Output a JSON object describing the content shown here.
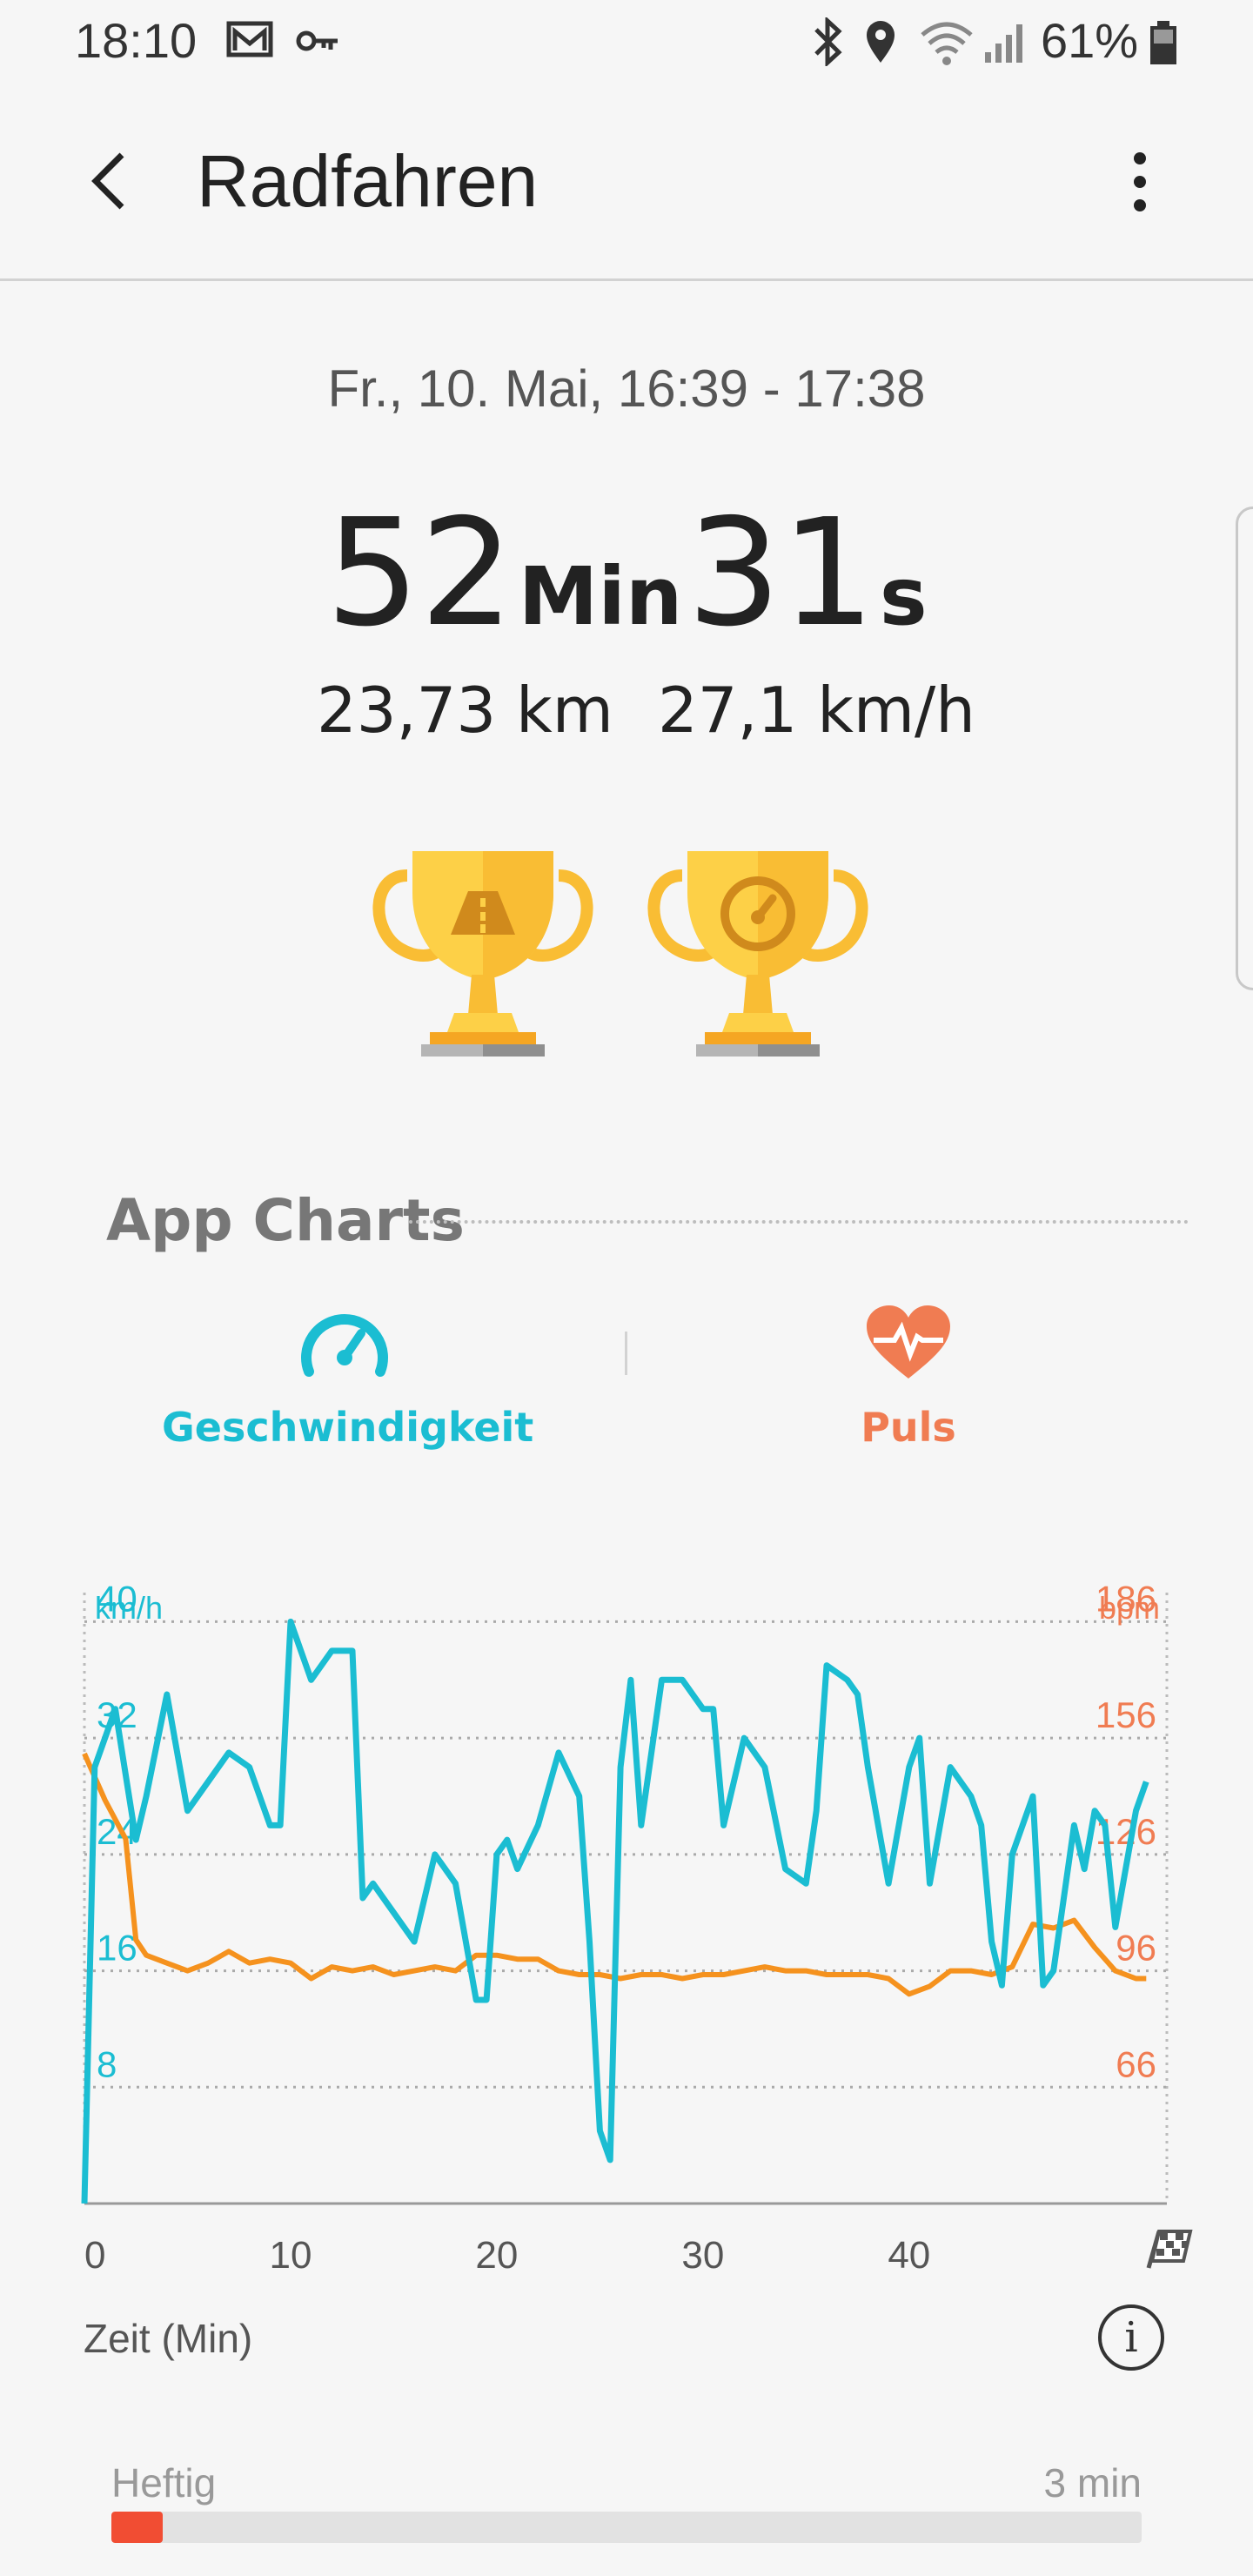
{
  "status_bar": {
    "time": "18:10",
    "battery": "61%"
  },
  "app_bar": {
    "title": "Radfahren"
  },
  "summary": {
    "date_range": "Fr., 10. Mai, 16:39 - 17:38",
    "duration_minutes": "52",
    "duration_min_unit": "Min",
    "duration_seconds": "31",
    "duration_sec_unit": "s",
    "distance": "23,73 km",
    "avg_speed": "27,1 km/h"
  },
  "achievements": [
    {
      "icon": "trophy-road-icon"
    },
    {
      "icon": "trophy-speedometer-icon"
    }
  ],
  "section": {
    "title": "App Charts"
  },
  "tabs": [
    {
      "label": "Geschwindigkeit",
      "icon": "speedometer-icon",
      "color": "#1bbdd2"
    },
    {
      "label": "Puls",
      "icon": "heart-icon",
      "color": "#f07c52"
    }
  ],
  "colors": {
    "speed": "#1bbdd2",
    "pulse": "#f5921e",
    "pulse_axis": "#f07c52",
    "intensity_bar": "#f14d33"
  },
  "chart_data": {
    "type": "line",
    "y_left_unit": "km/h",
    "y_right_unit": "bpm",
    "y_left_ticks": [
      8,
      16,
      24,
      32,
      40
    ],
    "y_right_ticks": [
      66,
      96,
      126,
      156,
      186
    ],
    "x_ticks": [
      0,
      10,
      20,
      30,
      40
    ],
    "xlabel": "Zeit (Min)",
    "xlim": [
      0,
      52.5
    ],
    "ylim_left": [
      0,
      42
    ],
    "series": [
      {
        "axis": "left",
        "points": [
          [
            0,
            0
          ],
          [
            0.5,
            30
          ],
          [
            1.5,
            34
          ],
          [
            2.5,
            25
          ],
          [
            3,
            28
          ],
          [
            4,
            35
          ],
          [
            5,
            27
          ],
          [
            6,
            29
          ],
          [
            7,
            31
          ],
          [
            8,
            30
          ],
          [
            9,
            26
          ],
          [
            9.5,
            26
          ],
          [
            10,
            40
          ],
          [
            10.5,
            38
          ],
          [
            11,
            36
          ],
          [
            12,
            38
          ],
          [
            13,
            38
          ],
          [
            13.5,
            21
          ],
          [
            14,
            22
          ],
          [
            15,
            20
          ],
          [
            16,
            18
          ],
          [
            17,
            24
          ],
          [
            18,
            22
          ],
          [
            19,
            14
          ],
          [
            19.5,
            14
          ],
          [
            20,
            24
          ],
          [
            20.5,
            25
          ],
          [
            21,
            23
          ],
          [
            22,
            26
          ],
          [
            23,
            31
          ],
          [
            24,
            28
          ],
          [
            24.5,
            18
          ],
          [
            25,
            5
          ],
          [
            25.5,
            3
          ],
          [
            26,
            30
          ],
          [
            26.5,
            36
          ],
          [
            27,
            26
          ],
          [
            28,
            36
          ],
          [
            29,
            36
          ],
          [
            30,
            34
          ],
          [
            30.5,
            34
          ],
          [
            31,
            26
          ],
          [
            32,
            32
          ],
          [
            33,
            30
          ],
          [
            34,
            23
          ],
          [
            35,
            22
          ],
          [
            35.5,
            27
          ],
          [
            36,
            37
          ],
          [
            37,
            36
          ],
          [
            37.5,
            35
          ],
          [
            38,
            30
          ],
          [
            39,
            22
          ],
          [
            40,
            30
          ],
          [
            40.5,
            32
          ],
          [
            41,
            22
          ],
          [
            42,
            30
          ],
          [
            43,
            28
          ],
          [
            43.5,
            26
          ],
          [
            44,
            18
          ],
          [
            44.5,
            15
          ],
          [
            45,
            24
          ],
          [
            46,
            28
          ],
          [
            46.5,
            15
          ],
          [
            47,
            16
          ],
          [
            48,
            26
          ],
          [
            48.5,
            23
          ],
          [
            49,
            27
          ],
          [
            49.5,
            26
          ],
          [
            50,
            19
          ],
          [
            51,
            27
          ],
          [
            51.5,
            29
          ]
        ]
      },
      {
        "axis": "right",
        "points": [
          [
            0,
            152
          ],
          [
            1,
            140
          ],
          [
            2,
            130
          ],
          [
            2.5,
            104
          ],
          [
            3,
            100
          ],
          [
            4,
            98
          ],
          [
            5,
            96
          ],
          [
            6,
            98
          ],
          [
            7,
            101
          ],
          [
            8,
            98
          ],
          [
            9,
            99
          ],
          [
            10,
            98
          ],
          [
            11,
            94
          ],
          [
            12,
            97
          ],
          [
            13,
            96
          ],
          [
            14,
            97
          ],
          [
            15,
            95
          ],
          [
            16,
            96
          ],
          [
            17,
            97
          ],
          [
            18,
            96
          ],
          [
            19,
            100
          ],
          [
            20,
            100
          ],
          [
            21,
            99
          ],
          [
            22,
            99
          ],
          [
            23,
            96
          ],
          [
            24,
            95
          ],
          [
            25,
            95
          ],
          [
            26,
            94
          ],
          [
            27,
            95
          ],
          [
            28,
            95
          ],
          [
            29,
            94
          ],
          [
            30,
            95
          ],
          [
            31,
            95
          ],
          [
            32,
            96
          ],
          [
            33,
            97
          ],
          [
            34,
            96
          ],
          [
            35,
            96
          ],
          [
            36,
            95
          ],
          [
            37,
            95
          ],
          [
            38,
            95
          ],
          [
            39,
            94
          ],
          [
            40,
            90
          ],
          [
            41,
            92
          ],
          [
            42,
            96
          ],
          [
            43,
            96
          ],
          [
            44,
            95
          ],
          [
            45,
            97
          ],
          [
            46,
            108
          ],
          [
            47,
            107
          ],
          [
            48,
            109
          ],
          [
            49,
            102
          ],
          [
            50,
            96
          ],
          [
            51,
            94
          ],
          [
            51.5,
            94
          ]
        ]
      }
    ]
  },
  "chart_footer": {
    "xlabel": "Zeit (Min)",
    "finish_icon": "checkered-flag-icon",
    "info_icon": "info-icon"
  },
  "intensity": {
    "label": "Heftig",
    "value": "3 min",
    "fraction": 0.05
  }
}
